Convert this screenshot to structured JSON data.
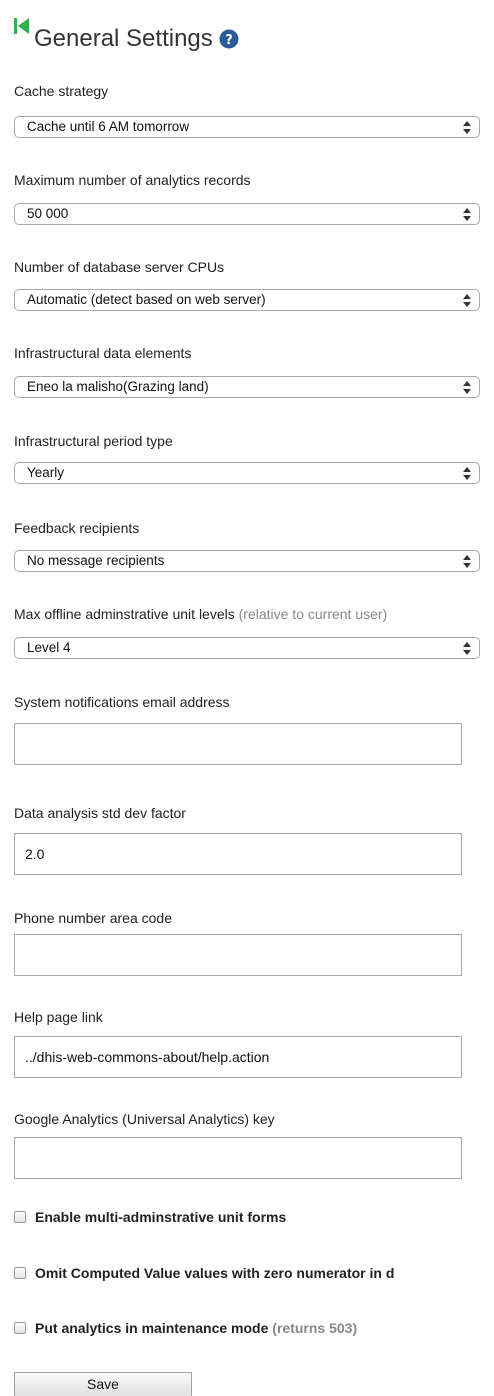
{
  "header": {
    "title": "General Settings"
  },
  "icons": {
    "back": "back-arrow-icon",
    "help": "help-icon",
    "select_arrows": "select-arrows-icon"
  },
  "colors": {
    "back_icon": "#2fb24a",
    "help_icon": "#2b5d9b"
  },
  "fields": {
    "cache_strategy": {
      "label": "Cache strategy",
      "value": "Cache until 6 AM tomorrow"
    },
    "max_analytics_records": {
      "label": "Maximum number of analytics records",
      "value": "50 000"
    },
    "db_server_cpus": {
      "label": "Number of database server CPUs",
      "value": "Automatic (detect based on web server)"
    },
    "infra_data_elements": {
      "label": "Infrastructural data elements",
      "value": "Eneo la malisho(Grazing land)"
    },
    "infra_period_type": {
      "label": "Infrastructural period type",
      "value": "Yearly"
    },
    "feedback_recipients": {
      "label": "Feedback recipients",
      "value": "No message recipients"
    },
    "max_offline_levels": {
      "label": "Max offline adminstrative unit levels",
      "note": "(relative to current user)",
      "value": "Level 4"
    },
    "notification_email": {
      "label": "System notifications email address",
      "value": ""
    },
    "std_dev_factor": {
      "label": "Data analysis std dev factor",
      "value": "2.0"
    },
    "phone_area_code": {
      "label": "Phone number area code",
      "value": ""
    },
    "help_page_link": {
      "label": "Help page link",
      "value": "../dhis-web-commons-about/help.action"
    },
    "google_analytics_key": {
      "label": "Google Analytics (Universal Analytics) key",
      "value": ""
    }
  },
  "checkboxes": {
    "multi_org_forms": {
      "label": "Enable multi-adminstrative unit forms",
      "checked": false
    },
    "omit_zero_numerator": {
      "label": "Omit Computed Value values with zero numerator in d",
      "checked": false
    },
    "analytics_maintenance": {
      "label": "Put analytics in maintenance mode",
      "note": "(returns 503)",
      "checked": false
    }
  },
  "actions": {
    "save_label": "Save"
  }
}
